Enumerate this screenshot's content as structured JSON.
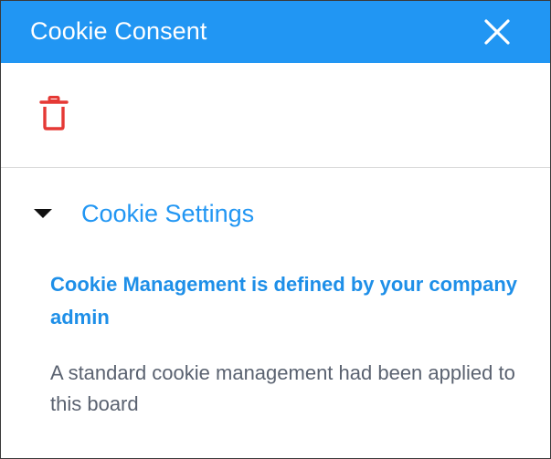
{
  "dialog": {
    "title": "Cookie Consent"
  },
  "icons": {
    "close": "close-icon",
    "delete": "trash-icon",
    "caret": "caret-down-icon"
  },
  "cookie_settings": {
    "title": "Cookie Settings",
    "admin_note": "Cookie Management is defined by your company admin",
    "description": "A standard cookie management had been applied to this board"
  },
  "colors": {
    "header_bg": "#2196f3",
    "accent": "#2196f3",
    "delete": "#e53935",
    "body_text": "#5a6270"
  }
}
